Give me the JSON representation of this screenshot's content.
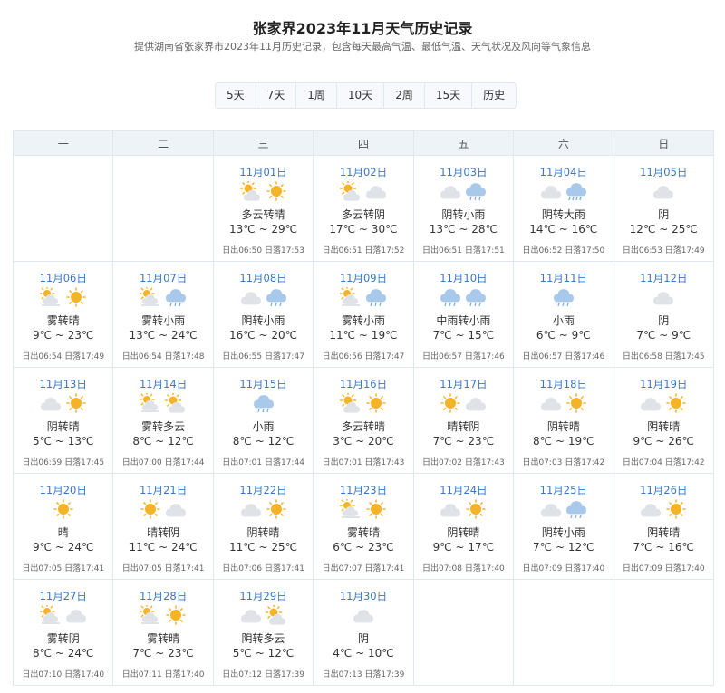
{
  "header": {
    "title": "张家界2023年11月天气历史记录",
    "subtitle": "提供湖南省张家界市2023年11月历史记录，包含每天最高气温、最低气温、天气状况及风向等气象信息"
  },
  "range_tabs": [
    "5天",
    "7天",
    "1周",
    "10天",
    "2周",
    "15天",
    "历史"
  ],
  "weekdays": [
    "一",
    "二",
    "三",
    "四",
    "五",
    "六",
    "日"
  ],
  "leading_blanks": 2,
  "days": [
    {
      "date": "11月01日",
      "icons": [
        "partly-cloudy-icon",
        "sunny-icon"
      ],
      "condition": "多云转晴",
      "temp": "13℃ ~ 29℃",
      "sun": "日出06:50 日落17:53"
    },
    {
      "date": "11月02日",
      "icons": [
        "partly-cloudy-icon",
        "cloudy-icon"
      ],
      "condition": "多云转阴",
      "temp": "17℃ ~ 30℃",
      "sun": "日出06:51 日落17:52"
    },
    {
      "date": "11月03日",
      "icons": [
        "cloudy-icon",
        "rain-icon"
      ],
      "condition": "阴转小雨",
      "temp": "13℃ ~ 28℃",
      "sun": "日出06:51 日落17:51"
    },
    {
      "date": "11月04日",
      "icons": [
        "cloudy-icon",
        "heavy-rain-icon"
      ],
      "condition": "阴转大雨",
      "temp": "14℃ ~ 16℃",
      "sun": "日出06:52 日落17:50"
    },
    {
      "date": "11月05日",
      "icons": [
        "cloudy-icon"
      ],
      "condition": "阴",
      "temp": "12℃ ~ 25℃",
      "sun": "日出06:53 日落17:49"
    },
    {
      "date": "11月06日",
      "icons": [
        "fog-icon",
        "sunny-icon"
      ],
      "condition": "雾转晴",
      "temp": "9℃ ~ 23℃",
      "sun": "日出06:54 日落17:49"
    },
    {
      "date": "11月07日",
      "icons": [
        "fog-icon",
        "rain-icon"
      ],
      "condition": "雾转小雨",
      "temp": "13℃ ~ 24℃",
      "sun": "日出06:54 日落17:48"
    },
    {
      "date": "11月08日",
      "icons": [
        "cloudy-icon",
        "rain-icon"
      ],
      "condition": "阴转小雨",
      "temp": "16℃ ~ 20℃",
      "sun": "日出06:55 日落17:47"
    },
    {
      "date": "11月09日",
      "icons": [
        "fog-icon",
        "rain-icon"
      ],
      "condition": "雾转小雨",
      "temp": "11℃ ~ 19℃",
      "sun": "日出06:56 日落17:47"
    },
    {
      "date": "11月10日",
      "icons": [
        "rain-icon",
        "rain-icon"
      ],
      "condition": "中雨转小雨",
      "temp": "7℃ ~ 15℃",
      "sun": "日出06:57 日落17:46"
    },
    {
      "date": "11月11日",
      "icons": [
        "rain-icon"
      ],
      "condition": "小雨",
      "temp": "6℃ ~ 9℃",
      "sun": "日出06:57 日落17:46"
    },
    {
      "date": "11月12日",
      "icons": [
        "cloudy-icon"
      ],
      "condition": "阴",
      "temp": "7℃ ~ 9℃",
      "sun": "日出06:58 日落17:45"
    },
    {
      "date": "11月13日",
      "icons": [
        "cloudy-icon",
        "sunny-icon"
      ],
      "condition": "阴转晴",
      "temp": "5℃ ~ 13℃",
      "sun": "日出06:59 日落17:45"
    },
    {
      "date": "11月14日",
      "icons": [
        "fog-icon",
        "partly-cloudy-icon"
      ],
      "condition": "雾转多云",
      "temp": "8℃ ~ 12℃",
      "sun": "日出07:00 日落17:44"
    },
    {
      "date": "11月15日",
      "icons": [
        "rain-icon"
      ],
      "condition": "小雨",
      "temp": "8℃ ~ 12℃",
      "sun": "日出07:01 日落17:44"
    },
    {
      "date": "11月16日",
      "icons": [
        "partly-cloudy-icon",
        "sunny-icon"
      ],
      "condition": "多云转晴",
      "temp": "3℃ ~ 20℃",
      "sun": "日出07:01 日落17:43"
    },
    {
      "date": "11月17日",
      "icons": [
        "sunny-icon",
        "cloudy-icon"
      ],
      "condition": "晴转阴",
      "temp": "7℃ ~ 23℃",
      "sun": "日出07:02 日落17:43"
    },
    {
      "date": "11月18日",
      "icons": [
        "cloudy-icon",
        "sunny-icon"
      ],
      "condition": "阴转晴",
      "temp": "8℃ ~ 19℃",
      "sun": "日出07:03 日落17:42"
    },
    {
      "date": "11月19日",
      "icons": [
        "cloudy-icon",
        "sunny-icon"
      ],
      "condition": "阴转晴",
      "temp": "9℃ ~ 26℃",
      "sun": "日出07:04 日落17:42"
    },
    {
      "date": "11月20日",
      "icons": [
        "sunny-icon"
      ],
      "condition": "晴",
      "temp": "9℃ ~ 24℃",
      "sun": "日出07:05 日落17:41"
    },
    {
      "date": "11月21日",
      "icons": [
        "sunny-icon",
        "cloudy-icon"
      ],
      "condition": "晴转阴",
      "temp": "11℃ ~ 24℃",
      "sun": "日出07:05 日落17:41"
    },
    {
      "date": "11月22日",
      "icons": [
        "cloudy-icon",
        "sunny-icon"
      ],
      "condition": "阴转晴",
      "temp": "11℃ ~ 25℃",
      "sun": "日出07:06 日落17:41"
    },
    {
      "date": "11月23日",
      "icons": [
        "fog-icon",
        "sunny-icon"
      ],
      "condition": "雾转晴",
      "temp": "6℃ ~ 23℃",
      "sun": "日出07:07 日落17:41"
    },
    {
      "date": "11月24日",
      "icons": [
        "cloudy-icon",
        "sunny-icon"
      ],
      "condition": "阴转晴",
      "temp": "9℃ ~ 17℃",
      "sun": "日出07:08 日落17:40"
    },
    {
      "date": "11月25日",
      "icons": [
        "cloudy-icon",
        "rain-icon"
      ],
      "condition": "阴转小雨",
      "temp": "7℃ ~ 12℃",
      "sun": "日出07:09 日落17:40"
    },
    {
      "date": "11月26日",
      "icons": [
        "cloudy-icon",
        "sunny-icon"
      ],
      "condition": "阴转晴",
      "temp": "7℃ ~ 16℃",
      "sun": "日出07:09 日落17:40"
    },
    {
      "date": "11月27日",
      "icons": [
        "fog-icon",
        "cloudy-icon"
      ],
      "condition": "雾转阴",
      "temp": "8℃ ~ 24℃",
      "sun": "日出07:10 日落17:40"
    },
    {
      "date": "11月28日",
      "icons": [
        "fog-icon",
        "sunny-icon"
      ],
      "condition": "雾转晴",
      "temp": "7℃ ~ 23℃",
      "sun": "日出07:11 日落17:40"
    },
    {
      "date": "11月29日",
      "icons": [
        "cloudy-icon",
        "partly-cloudy-icon"
      ],
      "condition": "阴转多云",
      "temp": "5℃ ~ 12℃",
      "sun": "日出07:12 日落17:39"
    },
    {
      "date": "11月30日",
      "icons": [
        "cloudy-icon"
      ],
      "condition": "阴",
      "temp": "4℃ ~ 10℃",
      "sun": "日出07:13 日落17:39"
    }
  ],
  "colors": {
    "date_text": "#3a77c4",
    "header_bg": "#eef3f8",
    "border": "#e1e7ee",
    "sun": "#f5b327",
    "cloud": "#dfe3e8",
    "rain": "#7cb0e6"
  }
}
